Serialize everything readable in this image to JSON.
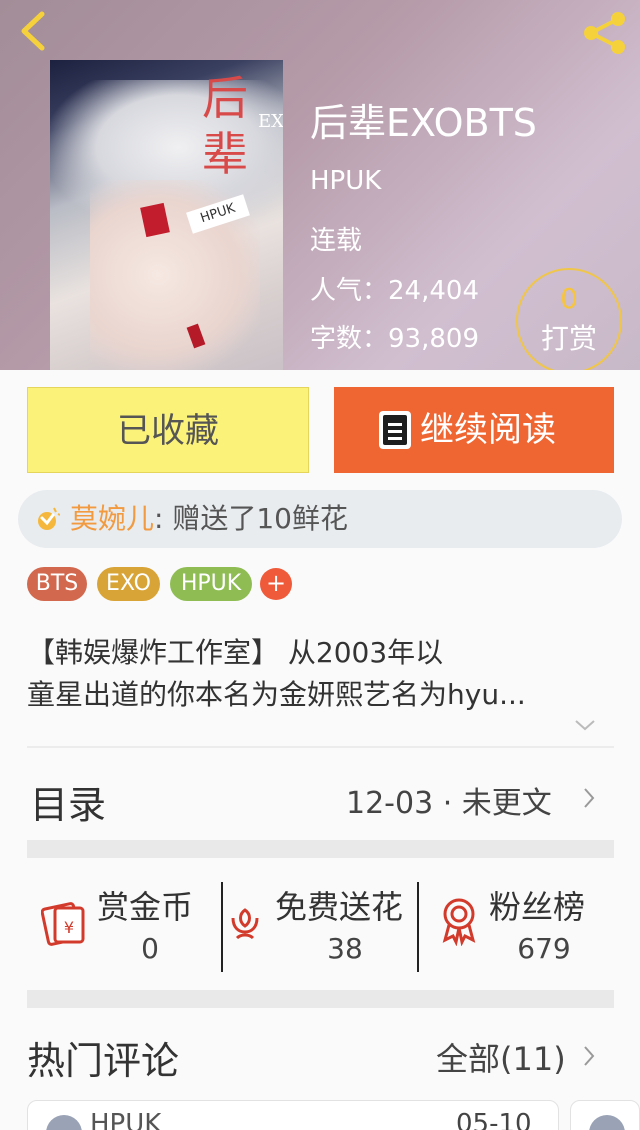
{
  "header": {
    "title": "后辈EXOBTS",
    "author": "HPUK",
    "status": "连载",
    "popularity_label": "人气：",
    "popularity_value": "24,404",
    "words_label": "字数：",
    "words_value": "93,809",
    "reward_count": "0",
    "reward_label": "打赏"
  },
  "cover": {
    "big_text": "后辈",
    "letters": "EXOBTS",
    "badge": "HPUK"
  },
  "actions": {
    "collected_label": "已收藏",
    "continue_label": "继续阅读"
  },
  "gift": {
    "user": "莫婉儿",
    "message": ": 赠送了10鲜花"
  },
  "tags": [
    {
      "label": "BTS",
      "color": "#d2694f"
    },
    {
      "label": "EXO",
      "color": "#d9a437"
    },
    {
      "label": "HPUK",
      "color": "#8fbd54"
    }
  ],
  "tag_add_label": "+",
  "intro": {
    "line1": "【韩娱爆炸工作室】 从2003年以",
    "line2": "童星出道的你本名为金妍熙艺名为hyu..."
  },
  "toc": {
    "title": "目录",
    "update": "12-03 · 未更文"
  },
  "stats": [
    {
      "label": "赏金币",
      "value": "0",
      "icon": "red-envelope-icon"
    },
    {
      "label": "免费送花",
      "value": "38",
      "icon": "flower-icon"
    },
    {
      "label": "粉丝榜",
      "value": "679",
      "icon": "medal-icon"
    }
  ],
  "comments": {
    "title": "热门评论",
    "all_label": "全部(11)",
    "first_user": "HPUK",
    "first_date": "05-10"
  },
  "colors": {
    "accent_orange": "#ef6633",
    "collected_yellow": "#fbf27a",
    "gift_user": "#f29a3f",
    "reward_gold": "#f7c53d"
  }
}
